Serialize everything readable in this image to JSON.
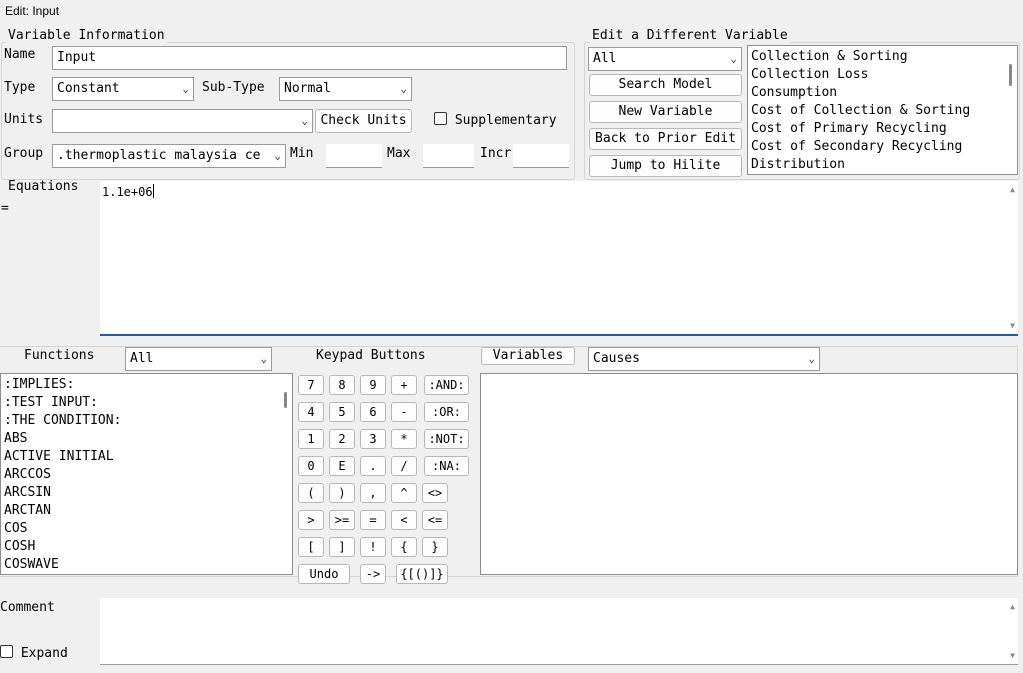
{
  "window": {
    "title": "Edit: Input"
  },
  "var_info": {
    "legend": "Variable Information",
    "name_label": "Name",
    "name_value": "Input",
    "type_label": "Type",
    "type_value": "Constant",
    "subtype_label": "Sub-Type",
    "subtype_value": "Normal",
    "units_label": "Units",
    "units_value": "",
    "check_units": "Check Units",
    "supplementary": "Supplementary",
    "group_label": "Group",
    "group_value": ".thermoplastic malaysia ce",
    "min_label": "Min",
    "min_value": "",
    "max_label": "Max",
    "max_value": "",
    "incr_label": "Incr",
    "incr_value": ""
  },
  "edit_diff": {
    "legend": "Edit a Different Variable",
    "filter_value": "All",
    "buttons": [
      "Search Model",
      "New Variable",
      "Back to Prior Edit",
      "Jump to Hilite"
    ],
    "variables": [
      "Collection & Sorting",
      "Collection Loss",
      "Consumption",
      "Cost of Collection & Sorting",
      "Cost of Primary Recycling",
      "Cost of Secondary Recycling",
      "Distribution"
    ]
  },
  "equations": {
    "label": "Equations",
    "equals": "=",
    "value": "1.1e+06"
  },
  "functions": {
    "label": "Functions",
    "filter_value": "All",
    "items": [
      ":IMPLIES:",
      ":TEST INPUT:",
      ":THE CONDITION:",
      "ABS",
      "ACTIVE INITIAL",
      "ARCCOS",
      "ARCSIN",
      "ARCTAN",
      "COS",
      "COSH",
      "COSWAVE"
    ]
  },
  "keypad": {
    "label": "Keypad Buttons",
    "rows": [
      [
        "7",
        "8",
        "9",
        "+",
        ":AND:"
      ],
      [
        "4",
        "5",
        "6",
        "-",
        ":OR:"
      ],
      [
        "1",
        "2",
        "3",
        "*",
        ":NOT:"
      ],
      [
        "0",
        "E",
        ".",
        "/",
        ":NA:"
      ],
      [
        "(",
        ")",
        ",",
        "^",
        "<>"
      ],
      [
        ">",
        ">=",
        "=",
        "<",
        "<="
      ],
      [
        "[",
        "]",
        "!",
        "{",
        "}"
      ]
    ],
    "undo": "Undo",
    "arrow": "->",
    "brackets": "{[()]}"
  },
  "variables_panel": {
    "button": "Variables",
    "filter_value": "Causes"
  },
  "comment": {
    "label": "Comment",
    "expand": "Expand",
    "value": ""
  }
}
